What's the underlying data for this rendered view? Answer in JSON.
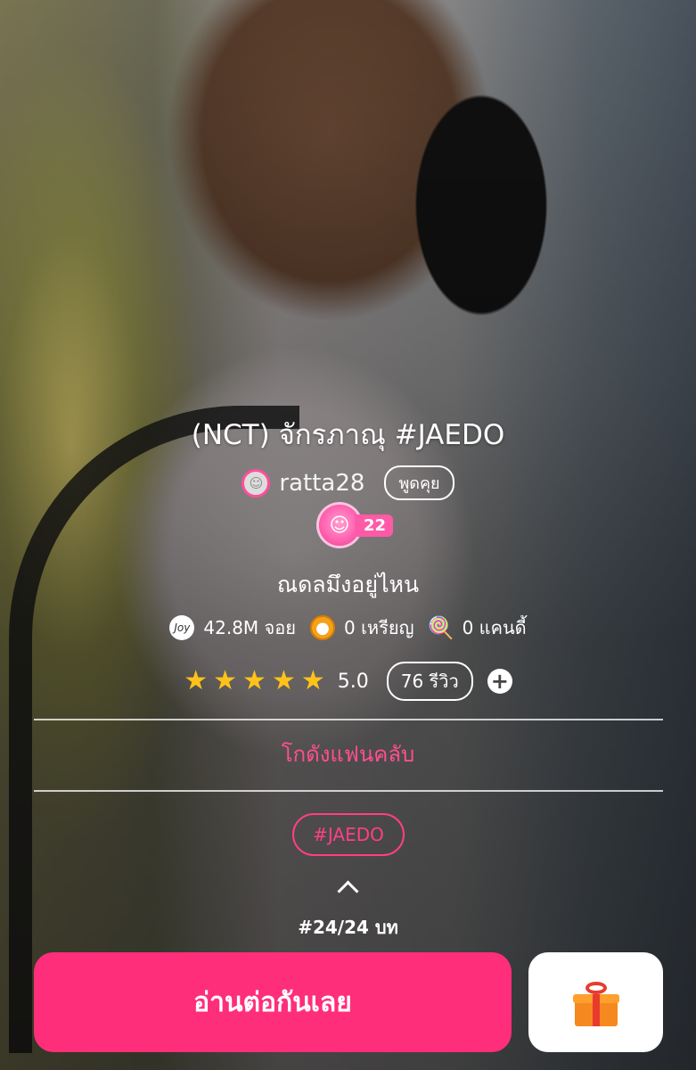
{
  "story": {
    "title": "(NCT) จักรภาณุ #JAEDO",
    "tagline": "ณดลมึงอยู่ไหน",
    "hashtag": "#JAEDO",
    "chapter": "#24/24 บท"
  },
  "author": {
    "name": "ratta28",
    "chat_label": "พูดคุย",
    "level": "22"
  },
  "stats": {
    "joy_icon_text": "Joy",
    "joy": "42.8M จอย",
    "coins": "0 เหรียญ",
    "candy": "0 แคนดี้"
  },
  "rating": {
    "stars": 5,
    "score": "5.0",
    "reviews": "76 รีวิว"
  },
  "fanclub_label": "โกดังแฟนคลับ",
  "actions": {
    "read_label": "อ่านต่อกันเลย"
  },
  "colors": {
    "accent": "#ff2e7a",
    "star": "#ffc21a"
  }
}
